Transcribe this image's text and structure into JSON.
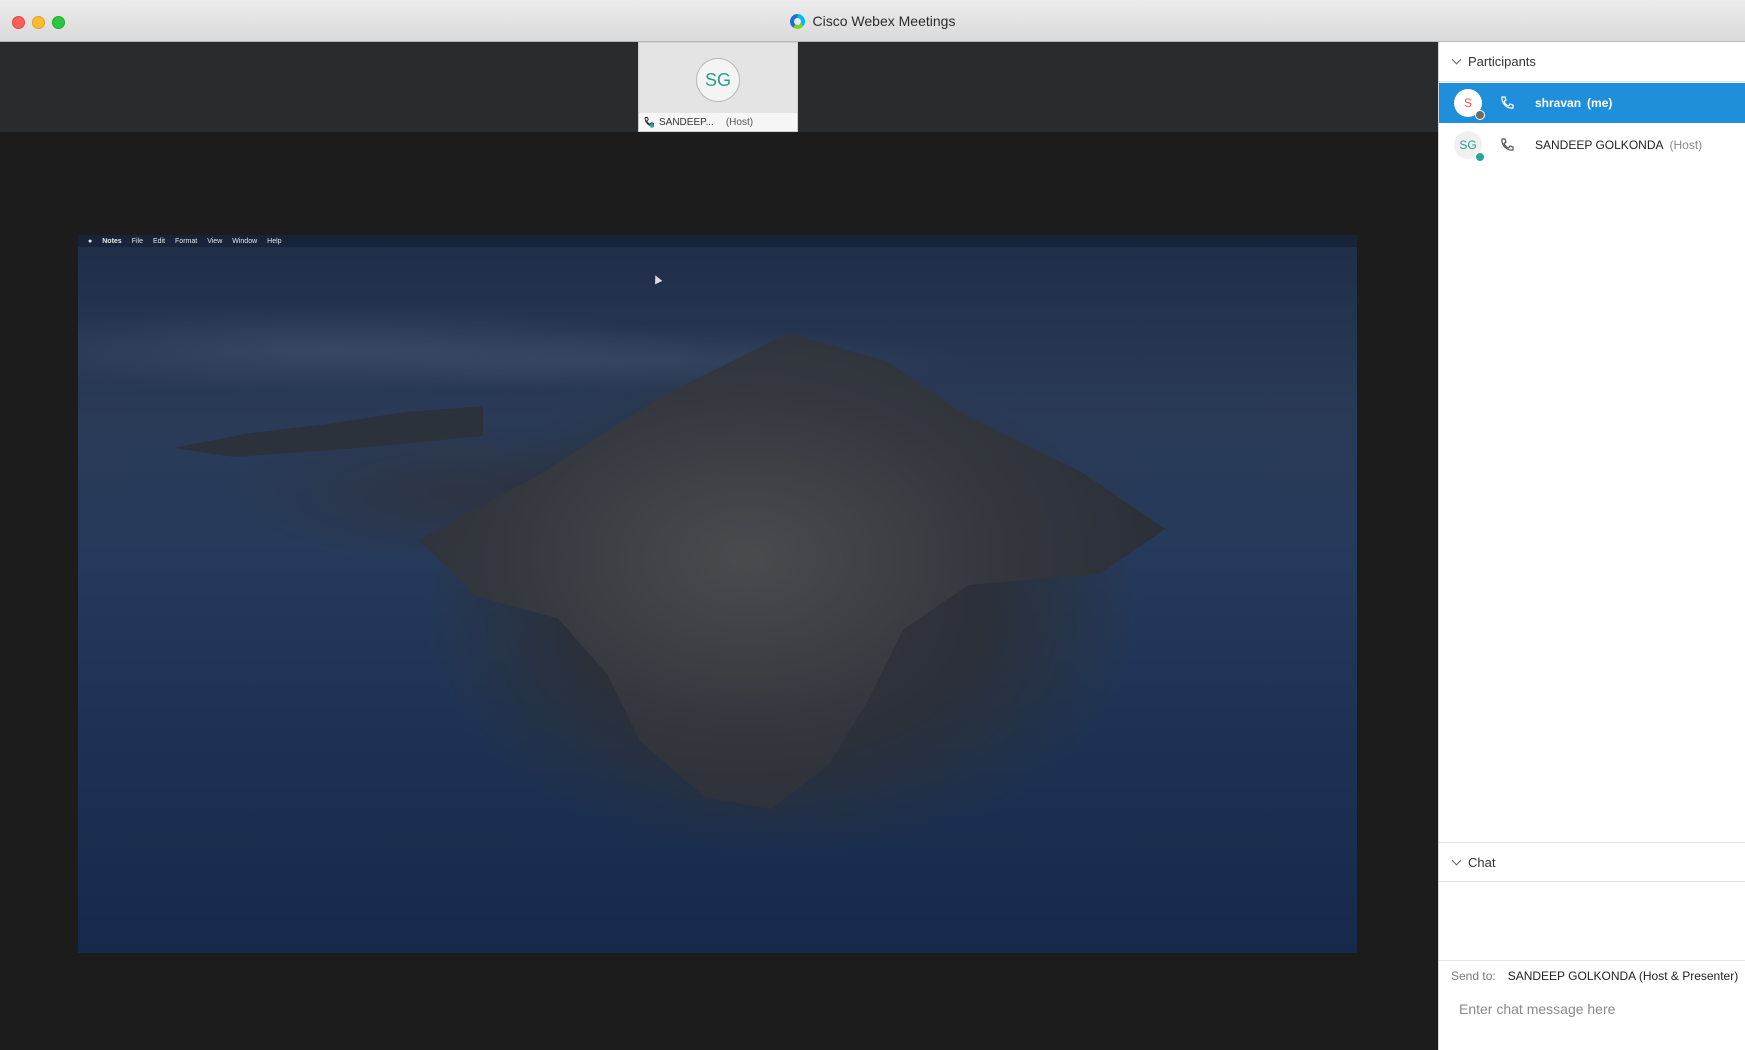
{
  "window": {
    "title": "Cisco Webex Meetings"
  },
  "video_tile": {
    "initials": "SG",
    "name": "SANDEEP...",
    "role": "(Host)"
  },
  "shared_screen": {
    "menubar": {
      "app": "Notes",
      "items": [
        "File",
        "Edit",
        "Format",
        "View",
        "Window",
        "Help"
      ]
    }
  },
  "participants": {
    "header": "Participants",
    "items": [
      {
        "initials": "S",
        "name": "shravan",
        "tag": "(me)",
        "selected": true
      },
      {
        "initials": "SG",
        "name": "SANDEEP GOLKONDA",
        "tag": "(Host)",
        "selected": false
      }
    ]
  },
  "chat": {
    "header": "Chat",
    "send_to_label": "Send to:",
    "send_to_value": "SANDEEP GOLKONDA (Host & Presenter)",
    "placeholder": "Enter chat message here"
  },
  "colors": {
    "selected_row": "#1f8fdc",
    "close": "#fe5f57",
    "minimize": "#febc2e",
    "maximize": "#28c840"
  }
}
